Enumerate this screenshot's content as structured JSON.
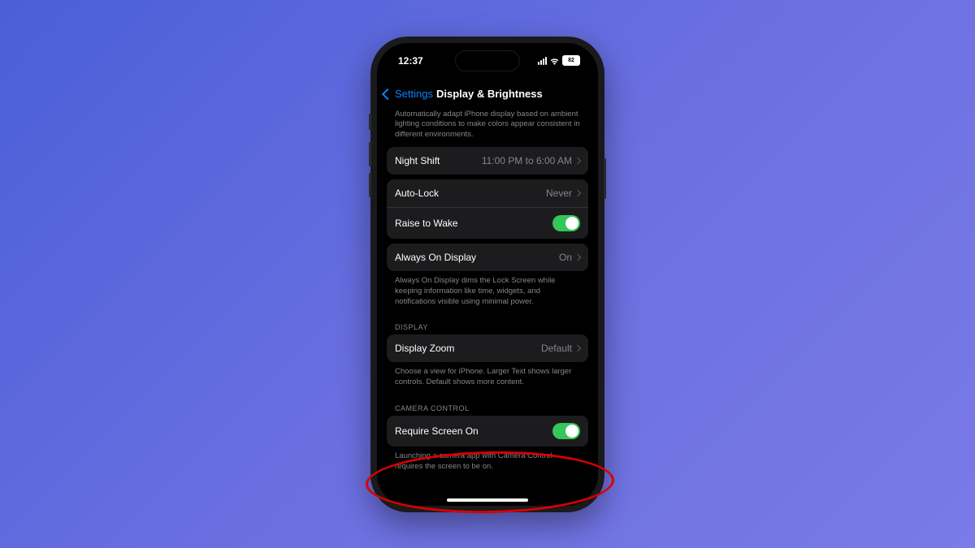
{
  "status": {
    "time": "12:37",
    "battery": "82"
  },
  "nav": {
    "back": "Settings",
    "title": "Display & Brightness"
  },
  "truetone_desc": "Automatically adapt iPhone display based on ambient lighting conditions to make colors appear consistent in different environments.",
  "nightshift": {
    "label": "Night Shift",
    "value": "11:00 PM to 6:00 AM"
  },
  "autolock": {
    "label": "Auto-Lock",
    "value": "Never"
  },
  "raise": {
    "label": "Raise to Wake"
  },
  "aod": {
    "label": "Always On Display",
    "value": "On",
    "desc": "Always On Display dims the Lock Screen while keeping information like time, widgets, and notifications visible using minimal power."
  },
  "display_header": "DISPLAY",
  "zoom": {
    "label": "Display Zoom",
    "value": "Default",
    "desc": "Choose a view for iPhone. Larger Text shows larger controls. Default shows more content."
  },
  "camera_header": "CAMERA CONTROL",
  "require": {
    "label": "Require Screen On",
    "desc": "Launching a camera app with Camera Control requires the screen to be on."
  }
}
